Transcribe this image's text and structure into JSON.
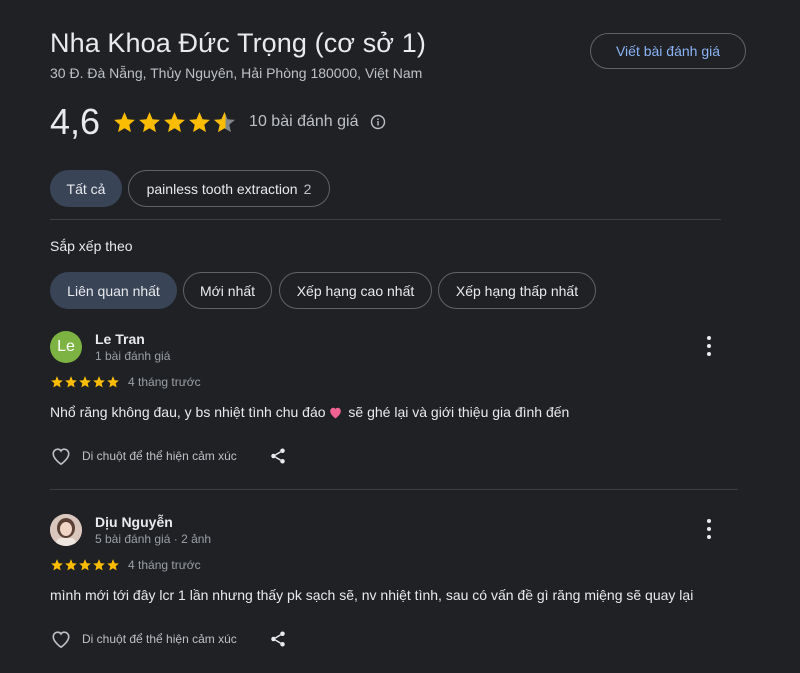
{
  "header": {
    "title": "Nha Khoa Đức Trọng (cơ sở 1)",
    "address": "30 Đ. Đà Nẵng, Thủy Nguyên, Hải Phòng 180000, Việt Nam",
    "write_review_label": "Viết bài đánh giá"
  },
  "rating": {
    "value": "4,6",
    "stars": 4.6,
    "count_text": "10 bài đánh giá",
    "star_color": "#fbbc04",
    "info_icon": "info-icon"
  },
  "filters": {
    "all_label": "Tất cả",
    "topic_label": "painless tooth extraction",
    "topic_count": "2"
  },
  "sort": {
    "label": "Sắp xếp theo",
    "options": [
      "Liên quan nhất",
      "Mới nhất",
      "Xếp hạng cao nhất",
      "Xếp hạng thấp nhất"
    ],
    "selected": "Liên quan nhất"
  },
  "reviews": [
    {
      "name": "Le Tran",
      "avatar_text": "Le",
      "avatar_color": "#7cb342",
      "meta": "1 bài đánh giá",
      "stars": 5,
      "time": "4 tháng trước",
      "text_before": "Nhổ răng không đau, y bs nhiệt tình chu đáo",
      "emoji": "heart",
      "text_after": " sẽ ghé lại và giới thiệu gia đình đến",
      "like_label": "Di chuột để thể hiện cảm xúc"
    },
    {
      "name": "Dịu Nguyễn",
      "avatar_text": "",
      "avatar_color": "#c9b2a6",
      "meta": "5 bài đánh giá · 2 ảnh",
      "stars": 5,
      "time": "4 tháng trước",
      "text": "mình mới tới đây lcr 1 lần nhưng thấy pk sạch sẽ, nv nhiệt tình, sau có vấn đề gì răng miệng sẽ quay lại",
      "like_label": "Di chuột để thể hiện cảm xúc"
    }
  ]
}
